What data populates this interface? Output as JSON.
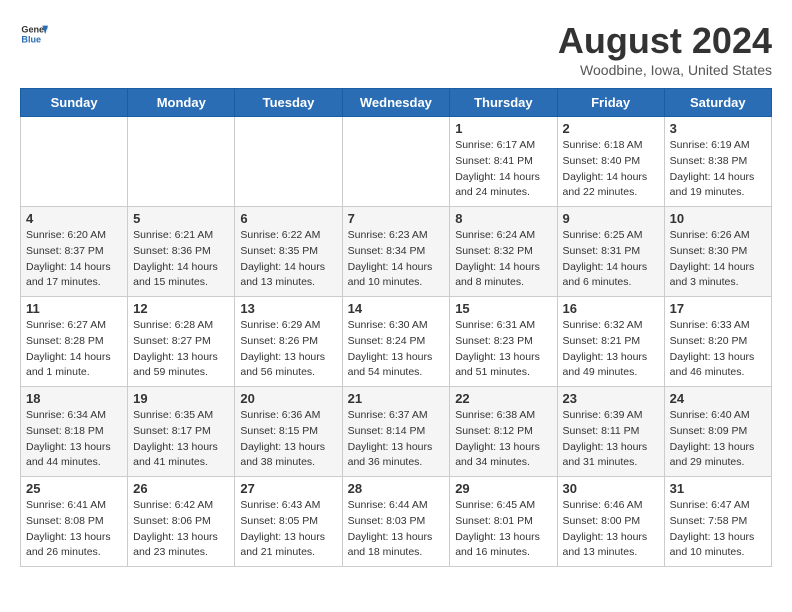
{
  "header": {
    "logo_general": "General",
    "logo_blue": "Blue",
    "title": "August 2024",
    "subtitle": "Woodbine, Iowa, United States"
  },
  "calendar": {
    "days_of_week": [
      "Sunday",
      "Monday",
      "Tuesday",
      "Wednesday",
      "Thursday",
      "Friday",
      "Saturday"
    ],
    "weeks": [
      [
        {
          "day": "",
          "content": ""
        },
        {
          "day": "",
          "content": ""
        },
        {
          "day": "",
          "content": ""
        },
        {
          "day": "",
          "content": ""
        },
        {
          "day": "1",
          "content": "Sunrise: 6:17 AM\nSunset: 8:41 PM\nDaylight: 14 hours\nand 24 minutes."
        },
        {
          "day": "2",
          "content": "Sunrise: 6:18 AM\nSunset: 8:40 PM\nDaylight: 14 hours\nand 22 minutes."
        },
        {
          "day": "3",
          "content": "Sunrise: 6:19 AM\nSunset: 8:38 PM\nDaylight: 14 hours\nand 19 minutes."
        }
      ],
      [
        {
          "day": "4",
          "content": "Sunrise: 6:20 AM\nSunset: 8:37 PM\nDaylight: 14 hours\nand 17 minutes."
        },
        {
          "day": "5",
          "content": "Sunrise: 6:21 AM\nSunset: 8:36 PM\nDaylight: 14 hours\nand 15 minutes."
        },
        {
          "day": "6",
          "content": "Sunrise: 6:22 AM\nSunset: 8:35 PM\nDaylight: 14 hours\nand 13 minutes."
        },
        {
          "day": "7",
          "content": "Sunrise: 6:23 AM\nSunset: 8:34 PM\nDaylight: 14 hours\nand 10 minutes."
        },
        {
          "day": "8",
          "content": "Sunrise: 6:24 AM\nSunset: 8:32 PM\nDaylight: 14 hours\nand 8 minutes."
        },
        {
          "day": "9",
          "content": "Sunrise: 6:25 AM\nSunset: 8:31 PM\nDaylight: 14 hours\nand 6 minutes."
        },
        {
          "day": "10",
          "content": "Sunrise: 6:26 AM\nSunset: 8:30 PM\nDaylight: 14 hours\nand 3 minutes."
        }
      ],
      [
        {
          "day": "11",
          "content": "Sunrise: 6:27 AM\nSunset: 8:28 PM\nDaylight: 14 hours\nand 1 minute."
        },
        {
          "day": "12",
          "content": "Sunrise: 6:28 AM\nSunset: 8:27 PM\nDaylight: 13 hours\nand 59 minutes."
        },
        {
          "day": "13",
          "content": "Sunrise: 6:29 AM\nSunset: 8:26 PM\nDaylight: 13 hours\nand 56 minutes."
        },
        {
          "day": "14",
          "content": "Sunrise: 6:30 AM\nSunset: 8:24 PM\nDaylight: 13 hours\nand 54 minutes."
        },
        {
          "day": "15",
          "content": "Sunrise: 6:31 AM\nSunset: 8:23 PM\nDaylight: 13 hours\nand 51 minutes."
        },
        {
          "day": "16",
          "content": "Sunrise: 6:32 AM\nSunset: 8:21 PM\nDaylight: 13 hours\nand 49 minutes."
        },
        {
          "day": "17",
          "content": "Sunrise: 6:33 AM\nSunset: 8:20 PM\nDaylight: 13 hours\nand 46 minutes."
        }
      ],
      [
        {
          "day": "18",
          "content": "Sunrise: 6:34 AM\nSunset: 8:18 PM\nDaylight: 13 hours\nand 44 minutes."
        },
        {
          "day": "19",
          "content": "Sunrise: 6:35 AM\nSunset: 8:17 PM\nDaylight: 13 hours\nand 41 minutes."
        },
        {
          "day": "20",
          "content": "Sunrise: 6:36 AM\nSunset: 8:15 PM\nDaylight: 13 hours\nand 38 minutes."
        },
        {
          "day": "21",
          "content": "Sunrise: 6:37 AM\nSunset: 8:14 PM\nDaylight: 13 hours\nand 36 minutes."
        },
        {
          "day": "22",
          "content": "Sunrise: 6:38 AM\nSunset: 8:12 PM\nDaylight: 13 hours\nand 34 minutes."
        },
        {
          "day": "23",
          "content": "Sunrise: 6:39 AM\nSunset: 8:11 PM\nDaylight: 13 hours\nand 31 minutes."
        },
        {
          "day": "24",
          "content": "Sunrise: 6:40 AM\nSunset: 8:09 PM\nDaylight: 13 hours\nand 29 minutes."
        }
      ],
      [
        {
          "day": "25",
          "content": "Sunrise: 6:41 AM\nSunset: 8:08 PM\nDaylight: 13 hours\nand 26 minutes."
        },
        {
          "day": "26",
          "content": "Sunrise: 6:42 AM\nSunset: 8:06 PM\nDaylight: 13 hours\nand 23 minutes."
        },
        {
          "day": "27",
          "content": "Sunrise: 6:43 AM\nSunset: 8:05 PM\nDaylight: 13 hours\nand 21 minutes."
        },
        {
          "day": "28",
          "content": "Sunrise: 6:44 AM\nSunset: 8:03 PM\nDaylight: 13 hours\nand 18 minutes."
        },
        {
          "day": "29",
          "content": "Sunrise: 6:45 AM\nSunset: 8:01 PM\nDaylight: 13 hours\nand 16 minutes."
        },
        {
          "day": "30",
          "content": "Sunrise: 6:46 AM\nSunset: 8:00 PM\nDaylight: 13 hours\nand 13 minutes."
        },
        {
          "day": "31",
          "content": "Sunrise: 6:47 AM\nSunset: 7:58 PM\nDaylight: 13 hours\nand 10 minutes."
        }
      ]
    ]
  }
}
